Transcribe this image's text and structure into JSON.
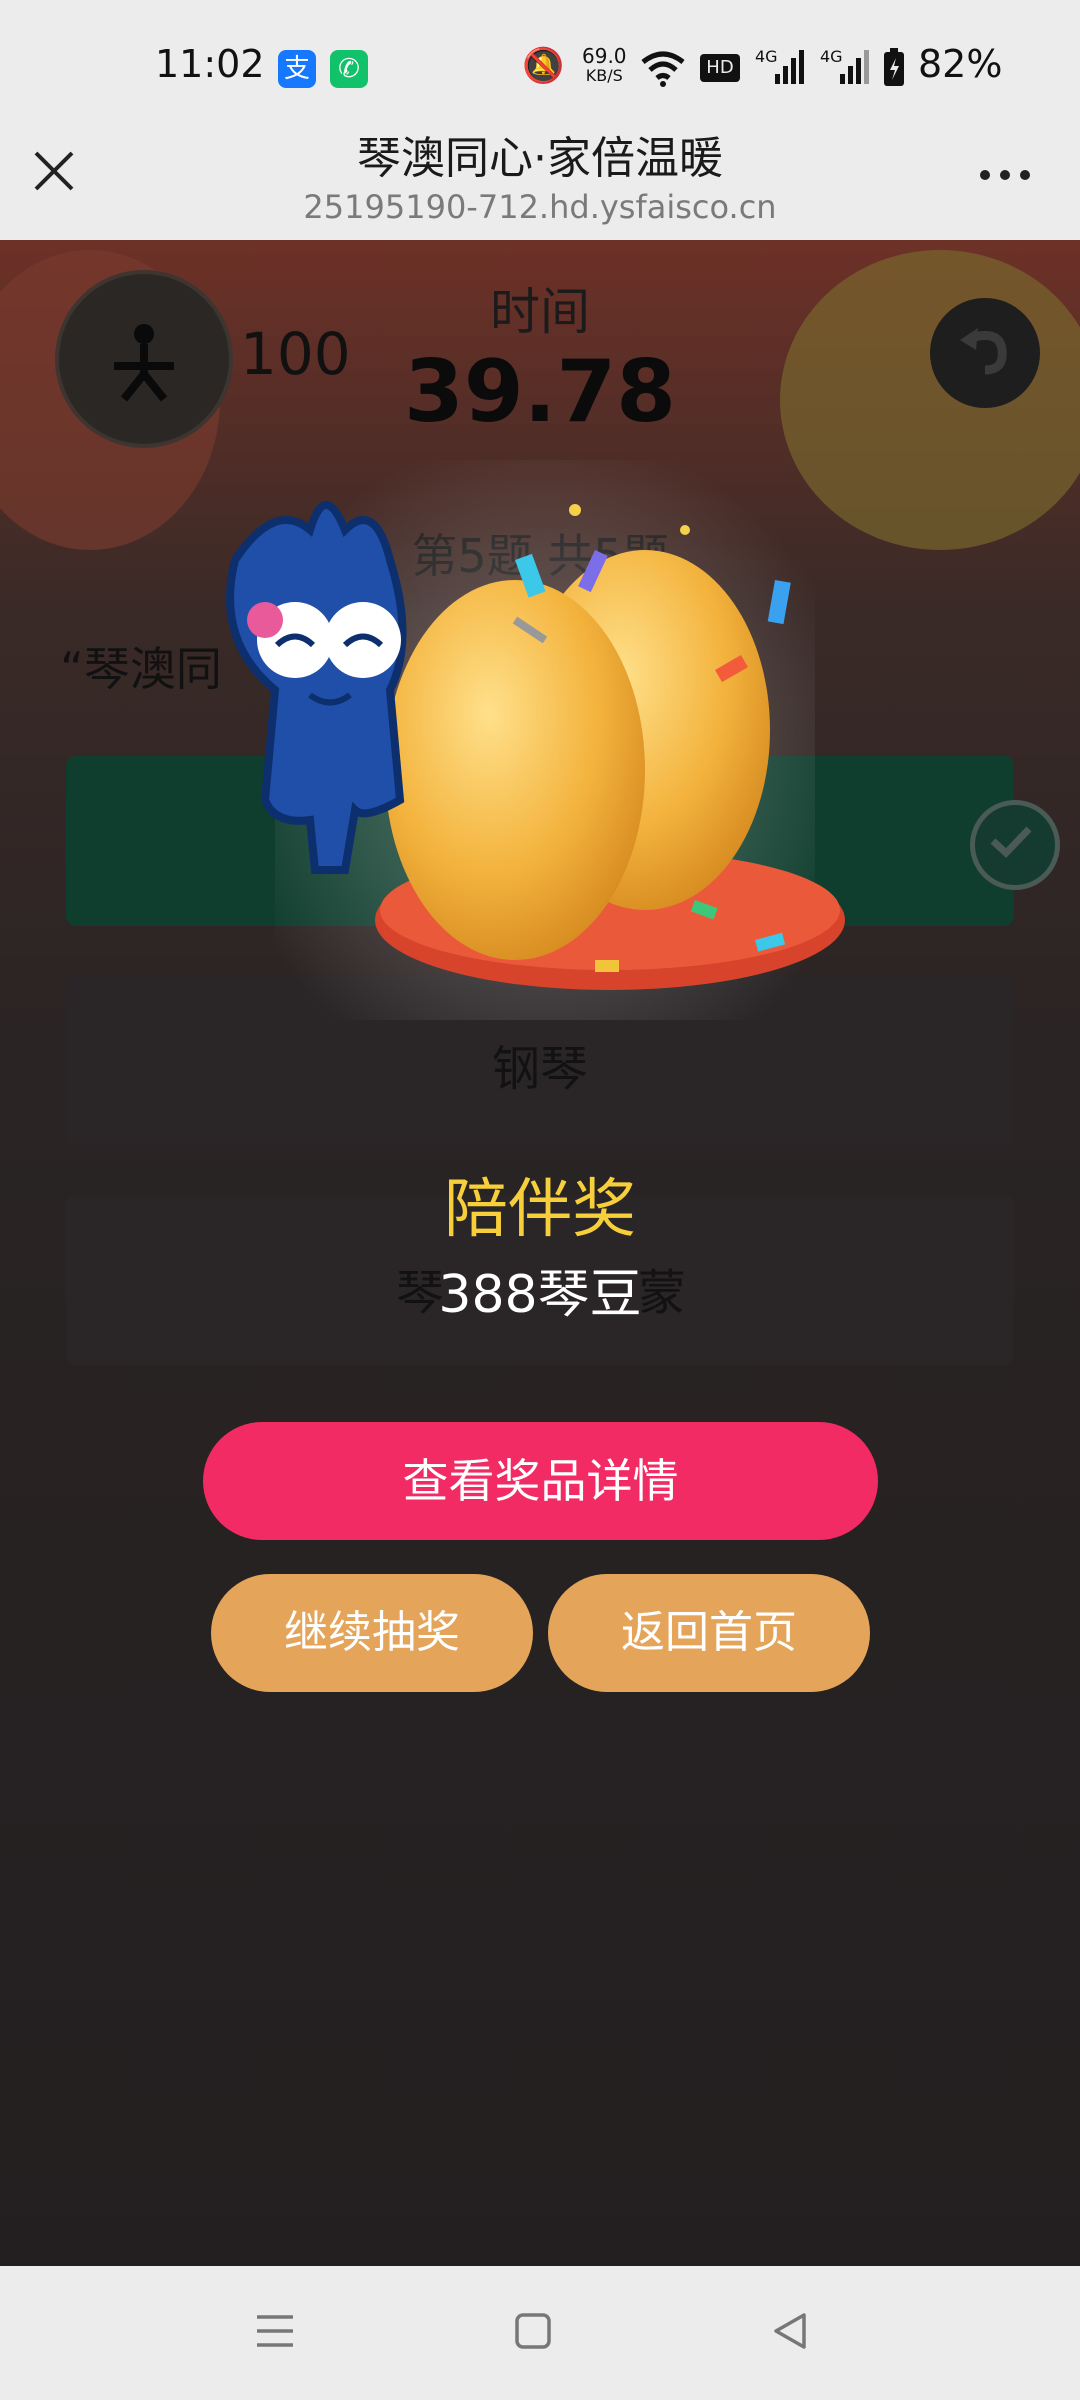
{
  "status_bar": {
    "time": "11:02",
    "net_speed": "69.0",
    "net_unit": "KB/S",
    "battery": "82%",
    "app_icons": [
      "alipay-icon",
      "phone-icon"
    ]
  },
  "nav": {
    "title": "琴澳同心·家倍温暖",
    "url": "25195190-712.hd.ysfaisco.cn"
  },
  "game": {
    "score": "100",
    "time_label": "时间",
    "time_value": "39.78",
    "progress": "第5题  共5题",
    "question_partial": "“琴澳同",
    "options": [
      "",
      "钢琴",
      "琴"
    ],
    "option3_tail": "蒙"
  },
  "modal": {
    "prize_name": "陪伴奖",
    "prize_amount": "388琴豆",
    "detail_button": "查看奖品详情",
    "continue_button": "继续抽奖",
    "home_button": "返回首页"
  },
  "colors": {
    "primary_button": "#f22b64",
    "secondary_button": "#e4a45a",
    "prize_text": "#f6cf3b"
  }
}
